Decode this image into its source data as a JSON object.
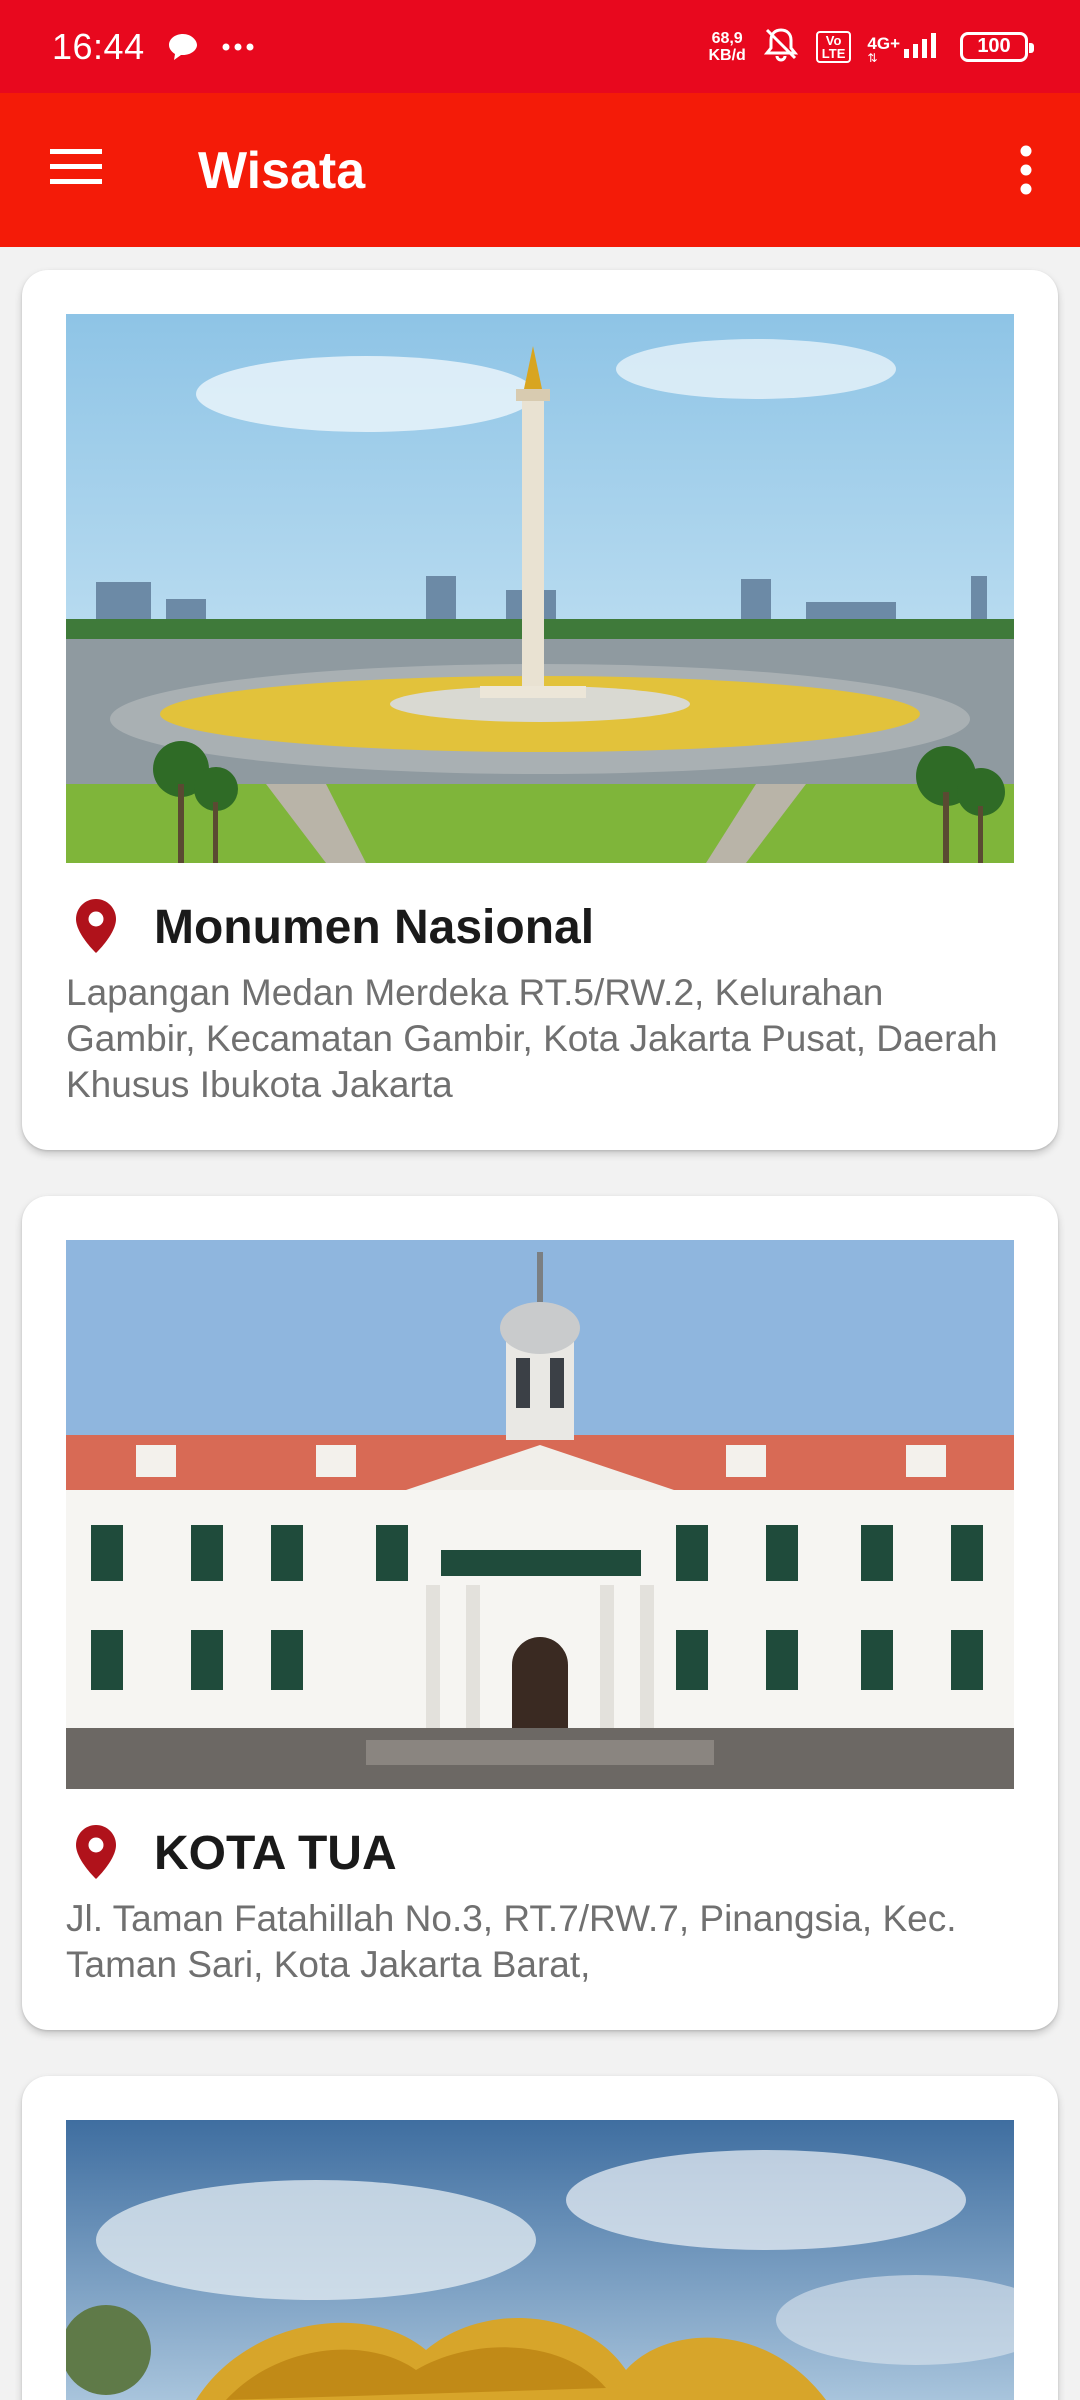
{
  "status_bar": {
    "time": "16:44",
    "net_speed_value": "68,9",
    "net_speed_unit": "KB/d",
    "volte_top": "Vo",
    "volte_bottom": "LTE",
    "network": "4G+",
    "battery": "100",
    "icons": [
      "chat-bubble-icon",
      "more-dots-icon",
      "bell-off-icon",
      "signal-icon"
    ]
  },
  "app_bar": {
    "title": "Wisata",
    "menu_icon": "hamburger-menu-icon",
    "overflow_icon": "more-vertical-icon",
    "background": "#f41b08"
  },
  "places": [
    {
      "name": "Monumen Nasional",
      "address": "Lapangan Medan Merdeka RT.5/RW.2, Kelurahan Gambir, Kecamatan Gambir, Kota Jakarta Pusat, Daerah Khusus Ibukota Jakarta"
    },
    {
      "name": "KOTA TUA",
      "address": "Jl. Taman Fatahillah No.3, RT.7/RW.7, Pinangsia, Kec. Taman Sari, Kota Jakarta Barat,"
    }
  ],
  "colors": {
    "status_bar": "#e8081e",
    "pin": "#b0121b",
    "address_text": "#707070"
  }
}
